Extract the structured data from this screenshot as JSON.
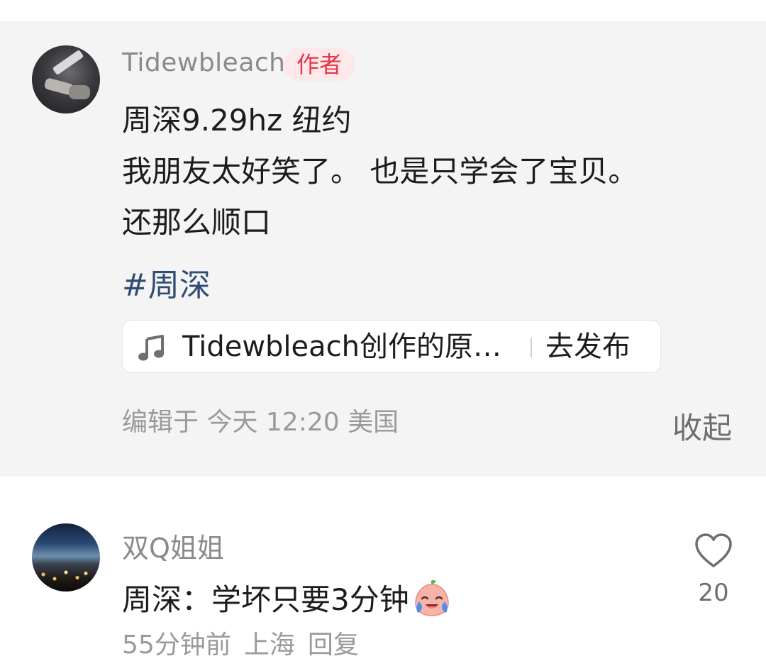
{
  "post": {
    "author": "Tidewbleach",
    "badge": "作者",
    "lines": [
      "周深9.29hz 纽约",
      "我朋友太好笑了。 也是只学会了宝贝。",
      "还那么顺口"
    ],
    "hashtag": "#周深",
    "music": {
      "title": "Tidewbleach创作的原…",
      "action": "去发布",
      "icon": "music-note-icon"
    },
    "meta": "编辑于 今天 12:20 美国",
    "collapse": "收起"
  },
  "comment": {
    "user": "双Q姐姐",
    "text": "周深：学坏只要3分钟",
    "emoji": "crying-laughing-peach-emoji",
    "time": "55分钟前",
    "location": "上海",
    "reply": "回复",
    "like_count": "20",
    "like_icon": "heart-outline-icon"
  },
  "colors": {
    "badge_bg": "#fde8ea",
    "badge_text": "#e8354a",
    "hashtag": "#2f4d73",
    "post_bg": "#f4f4f4"
  }
}
